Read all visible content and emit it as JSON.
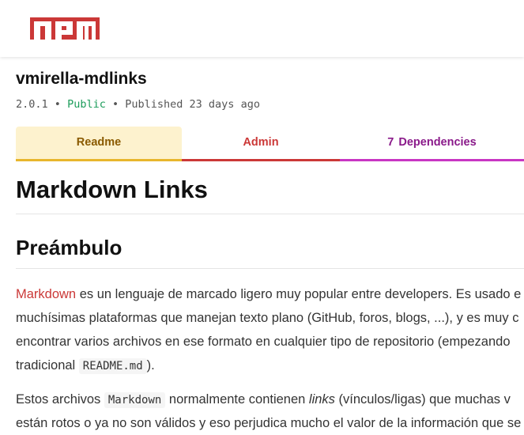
{
  "header": {
    "logo_text": "npm",
    "logo_color": "#cb3837"
  },
  "package": {
    "name": "vmirella-mdlinks",
    "version": "2.0.1",
    "sep1": "•",
    "visibility": "Public",
    "sep2": "•",
    "published": "Published 23 days ago"
  },
  "tabs": [
    {
      "label": "Readme"
    },
    {
      "label": "Admin"
    },
    {
      "count": "7",
      "label": "Dependencies"
    }
  ],
  "readme": {
    "title": "Markdown Links",
    "section": "Preámbulo",
    "p1": {
      "l1_link": "Markdown",
      "l1_text": " es un lenguaje de marcado ligero muy popular entre developers. Es usado e",
      "l2": "muchísimas plataformas que manejan texto plano (GitHub, foros, blogs, ...), y es muy c",
      "l3": "encontrar varios archivos en ese formato en cualquier tipo de repositorio (empezando",
      "l4_a": "tradicional ",
      "l4_code": "README.md",
      "l4_b": ")."
    },
    "p2": {
      "l1_a": "Estos archivos ",
      "l1_code": "Markdown",
      "l1_b": " normalmente contienen ",
      "l1_em": "links",
      "l1_c": " (vínculos/ligas) que muchas v",
      "l2": "están rotos o ya no son válidos y eso perjudica mucho el valor de la información que se"
    }
  }
}
